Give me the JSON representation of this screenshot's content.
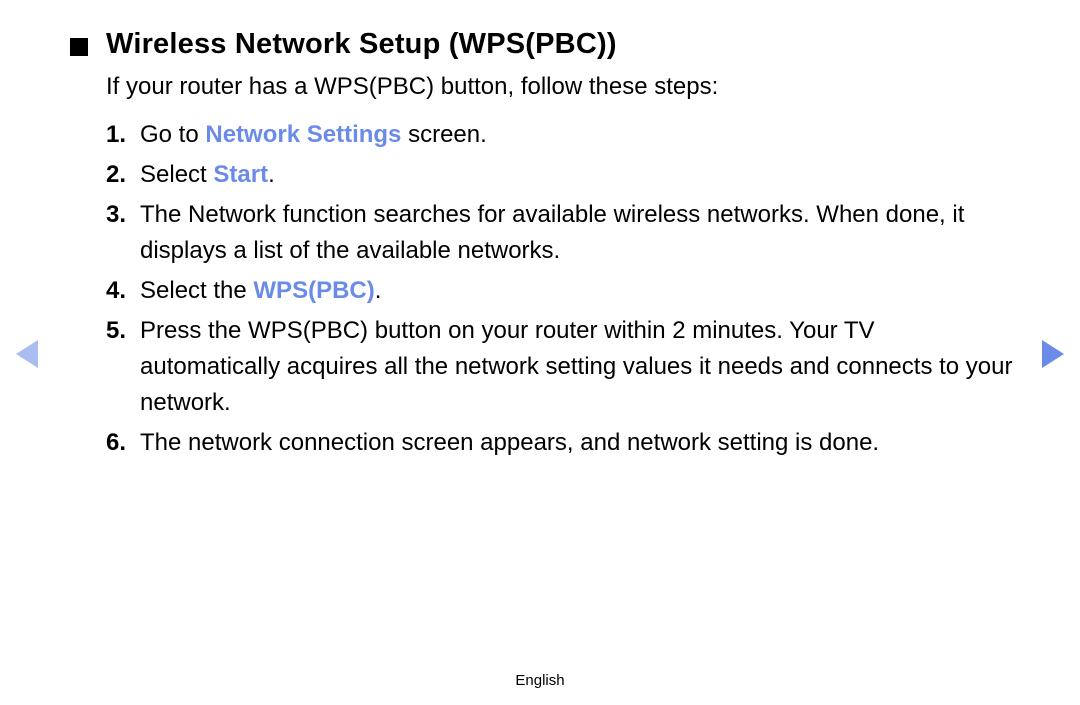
{
  "header": {
    "title": "Wireless Network Setup (WPS(PBC))"
  },
  "intro": "If your router has a WPS(PBC) button, follow these steps:",
  "steps": {
    "s1_num": "1.",
    "s1_a": "Go to ",
    "s1_hl": "Network Settings",
    "s1_b": " screen.",
    "s2_num": "2.",
    "s2_a": "Select ",
    "s2_hl": "Start",
    "s2_b": ".",
    "s3_num": "3.",
    "s3_a": "The Network function searches for available wireless networks. When done, it displays a list of the available networks.",
    "s4_num": "4.",
    "s4_a": "Select the ",
    "s4_hl": "WPS(PBC)",
    "s4_b": ".",
    "s5_num": "5.",
    "s5_a": "Press the WPS(PBC) button on your router within 2 minutes. Your TV automatically acquires all the network setting values it needs and connects to your network.",
    "s6_num": "6.",
    "s6_a": "The network connection screen appears, and network setting is done."
  },
  "footer": {
    "language": "English"
  }
}
